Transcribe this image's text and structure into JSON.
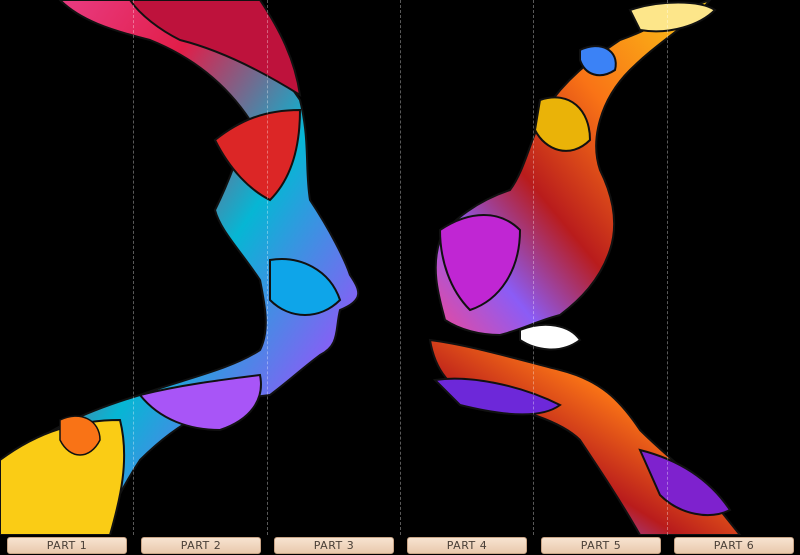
{
  "tabs": [
    {
      "label": "PART 1"
    },
    {
      "label": "PART 2"
    },
    {
      "label": "PART 3"
    },
    {
      "label": "PART 4"
    },
    {
      "label": "PART 5"
    },
    {
      "label": "PART 6"
    }
  ],
  "art": {
    "subject": "two-faces-profile-mosaic",
    "palette": [
      "#e11d48",
      "#f97316",
      "#facc15",
      "#22c55e",
      "#06b6d4",
      "#3b82f6",
      "#8b5cf6",
      "#ec4899",
      "#ffffff"
    ]
  }
}
